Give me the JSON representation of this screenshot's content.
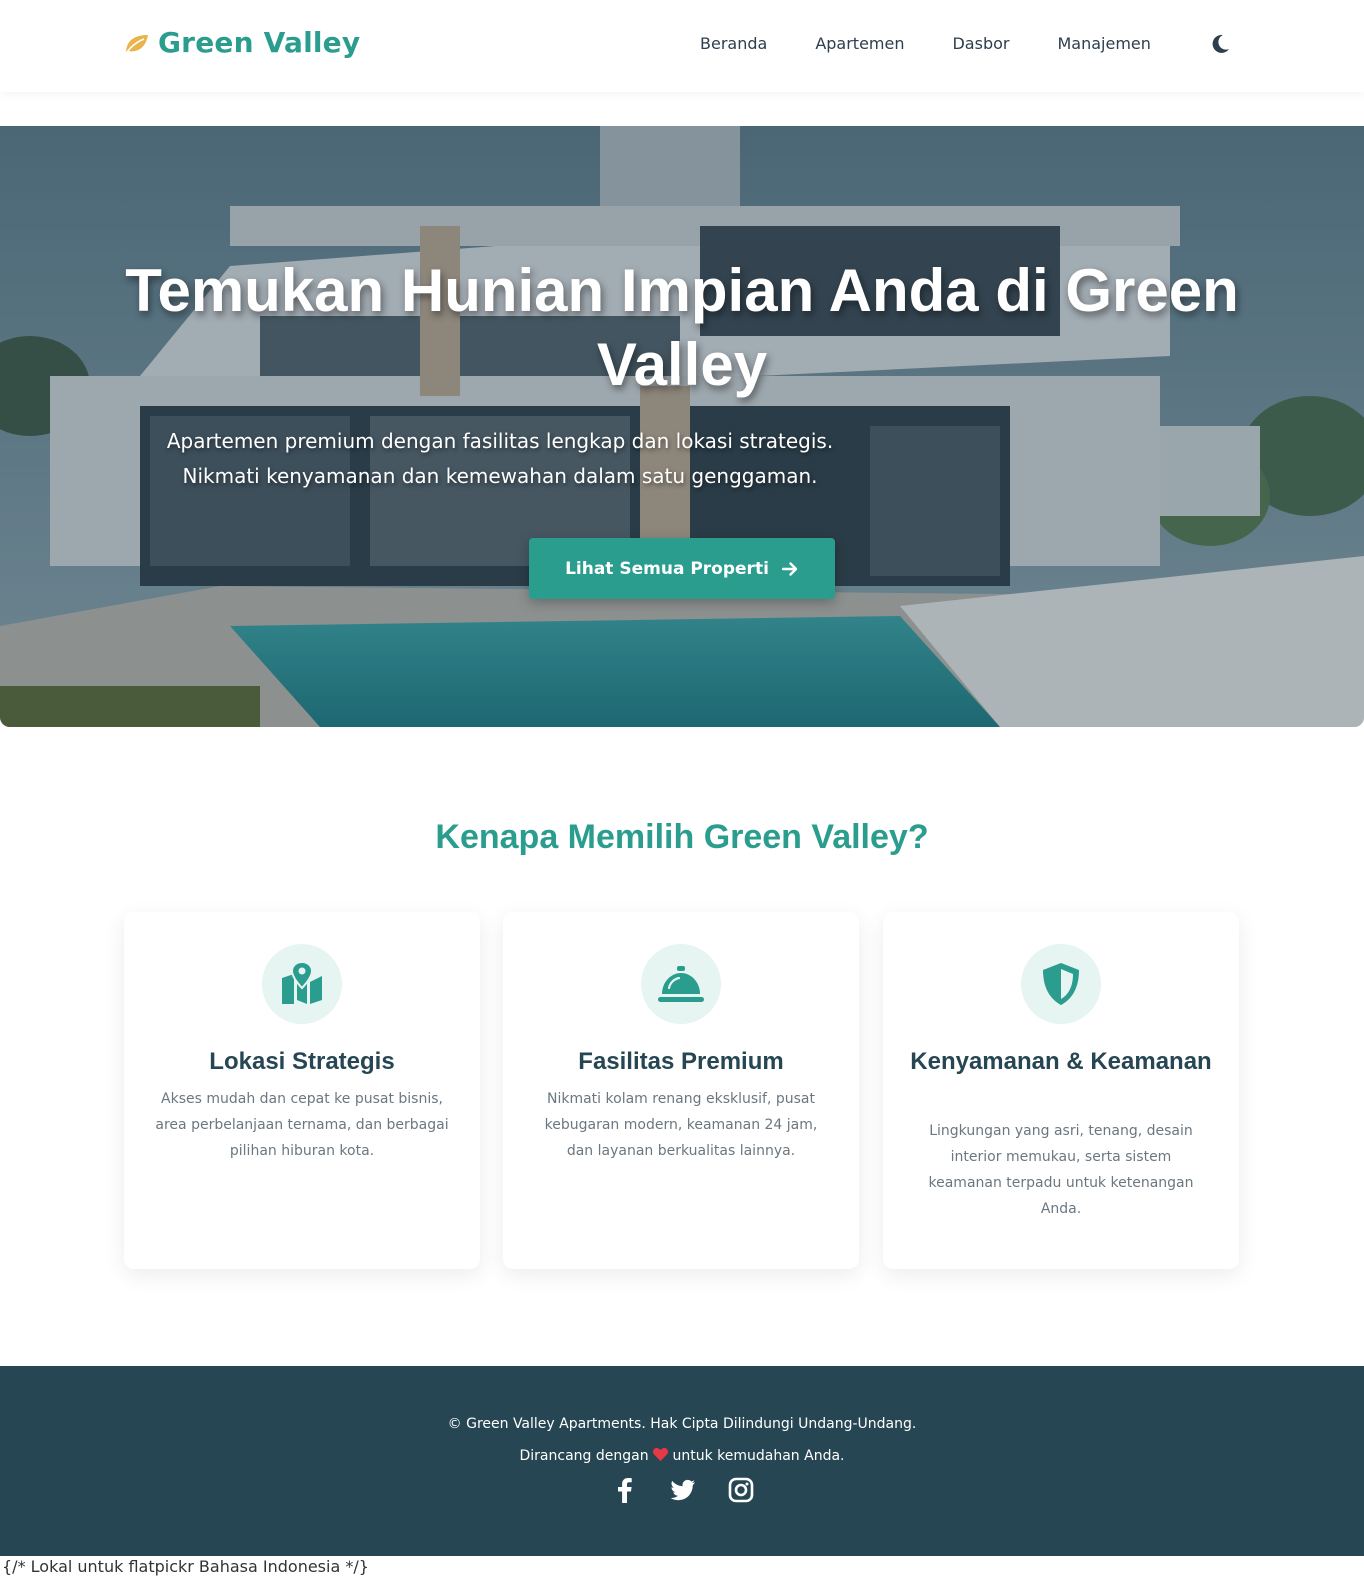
{
  "brand": {
    "name": "Green Valley",
    "icon": "leaf-icon"
  },
  "nav": {
    "items": [
      {
        "label": "Beranda"
      },
      {
        "label": "Apartemen"
      },
      {
        "label": "Dasbor"
      },
      {
        "label": "Manajemen"
      }
    ],
    "theme_icon": "moon-icon"
  },
  "hero": {
    "title": "Temukan Hunian Impian Anda di Green Valley",
    "subtitle_line1": "Apartemen premium dengan fasilitas lengkap dan lokasi strategis.",
    "subtitle_line2": "Nikmati kenyamanan dan kemewahan dalam satu genggaman.",
    "button_label": "Lihat Semua Properti",
    "button_icon": "arrow-right-icon"
  },
  "features": {
    "title": "Kenapa Memilih Green Valley?",
    "cards": [
      {
        "icon": "map-location-icon",
        "title": "Lokasi Strategis",
        "text": "Akses mudah dan cepat ke pusat bisnis, area perbelanjaan ternama, dan berbagai pilihan hiburan kota."
      },
      {
        "icon": "concierge-bell-icon",
        "title": "Fasilitas Premium",
        "text": "Nikmati kolam renang eksklusif, pusat kebugaran modern, keamanan 24 jam, dan layanan berkualitas lainnya."
      },
      {
        "icon": "shield-icon",
        "title": "Kenyamanan & Keamanan",
        "text": "Lingkungan yang asri, tenang, desain interior memukau, serta sistem keamanan terpadu untuk ketenangan Anda."
      }
    ]
  },
  "footer": {
    "copyright": "© Green Valley Apartments. Hak Cipta Dilindungi Undang-Undang.",
    "made_prefix": "Dirancang dengan",
    "made_suffix": "untuk kemudahan Anda.",
    "socials": [
      "facebook-icon",
      "twitter-icon",
      "instagram-icon"
    ]
  },
  "stray_text": "{/* Lokal untuk flatpickr Bahasa Indonesia */}",
  "colors": {
    "primary": "#2a9d8f",
    "dark": "#264653",
    "accent": "#e9b44c",
    "heart": "#e63946"
  }
}
